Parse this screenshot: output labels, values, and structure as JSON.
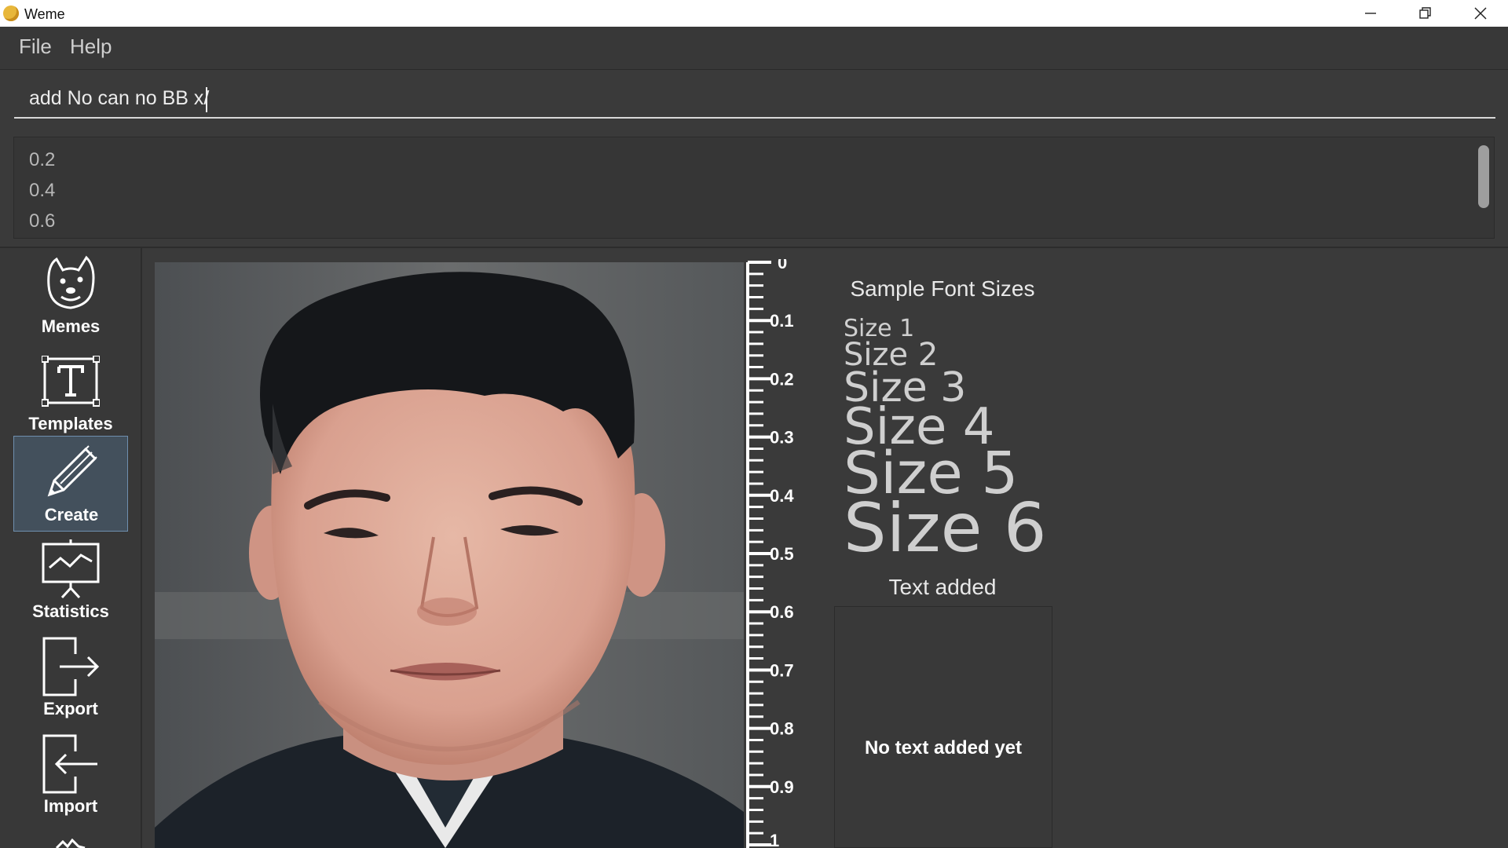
{
  "window": {
    "title": "Weme",
    "icon": "weme-logo-icon"
  },
  "menu": {
    "items": [
      "File",
      "Help"
    ]
  },
  "command": {
    "value": "add No can no BB x/"
  },
  "suggestions": [
    "0.2",
    "0.4",
    "0.6"
  ],
  "sidebar": {
    "items": [
      {
        "label": "Memes",
        "icon": "doge-icon"
      },
      {
        "label": "Templates",
        "icon": "template-icon"
      },
      {
        "label": "Create",
        "icon": "pencil-icon",
        "active": true
      },
      {
        "label": "Statistics",
        "icon": "chart-presentation-icon"
      },
      {
        "label": "Export",
        "icon": "export-icon"
      },
      {
        "label": "Import",
        "icon": "import-icon"
      }
    ]
  },
  "ruler": {
    "ticks": [
      "0",
      "0.1",
      "0.2",
      "0.3",
      "0.4",
      "0.5",
      "0.6",
      "0.7",
      "0.8",
      "0.9",
      "1"
    ]
  },
  "font_panel": {
    "title": "Sample Font Sizes",
    "sizes": [
      "Size 1",
      "Size 2",
      "Size 3",
      "Size 4",
      "Size 5",
      "Size 6"
    ]
  },
  "text_panel": {
    "title": "Text added",
    "empty_message": "No text added yet"
  },
  "colors": {
    "background": "#3a3a3a",
    "active_nav": "#43505c",
    "active_border": "#6f8fae"
  }
}
